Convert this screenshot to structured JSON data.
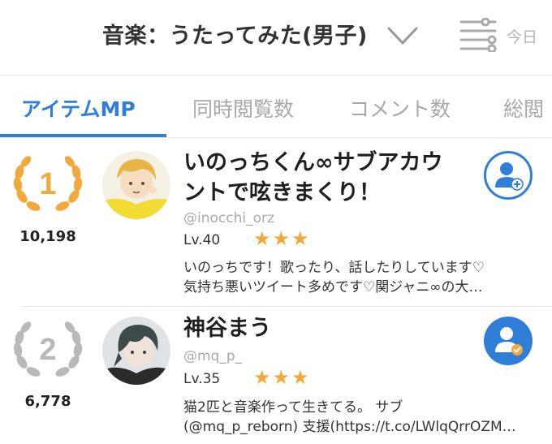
{
  "header": {
    "title": "音楽：うたってみた(男子)",
    "today_label": "今日"
  },
  "tabs": [
    {
      "label": "アイテムMP",
      "active": true
    },
    {
      "label": "同時閲覧数",
      "active": false
    },
    {
      "label": "コメント数",
      "active": false
    },
    {
      "label": "総閲",
      "active": false
    }
  ],
  "ranking": [
    {
      "rank": "1",
      "score": "10,198",
      "name_line1": "いのっちくん∞サブアカウ",
      "name_line2": "ントで呟きまくり！",
      "handle": "@inocchi_orz",
      "level": "Lv.40",
      "stars": "★★★",
      "bio_line1": "いのっちです！歌ったり、話したりしています♡",
      "bio_line2": "気持ち悪いツイート多めです♡関ジャニ∞の大…",
      "follow_state": "not-following"
    },
    {
      "rank": "2",
      "score": "6,778",
      "name_line1": "神谷まう",
      "handle": "@mq_p_",
      "level": "Lv.35",
      "stars": "★★★",
      "bio_line1": "猫2匹と音楽作って生きてる。 サブ",
      "bio_line2": "(@mq_p_reborn) 支援(https://t.co/LWlqQrrOZM…",
      "follow_state": "following"
    }
  ],
  "colors": {
    "accent": "#2f7fd8",
    "gold": "#f2a93b",
    "silver": "#b9b9b9",
    "muted_text": "#a8a8a8"
  },
  "icons": {
    "dropdown": "chevron-down-icon",
    "filter": "filter-sliders-icon",
    "follow": "add-user-icon",
    "following": "user-check-icon",
    "rank_badge": "laurel-wreath-icon"
  }
}
